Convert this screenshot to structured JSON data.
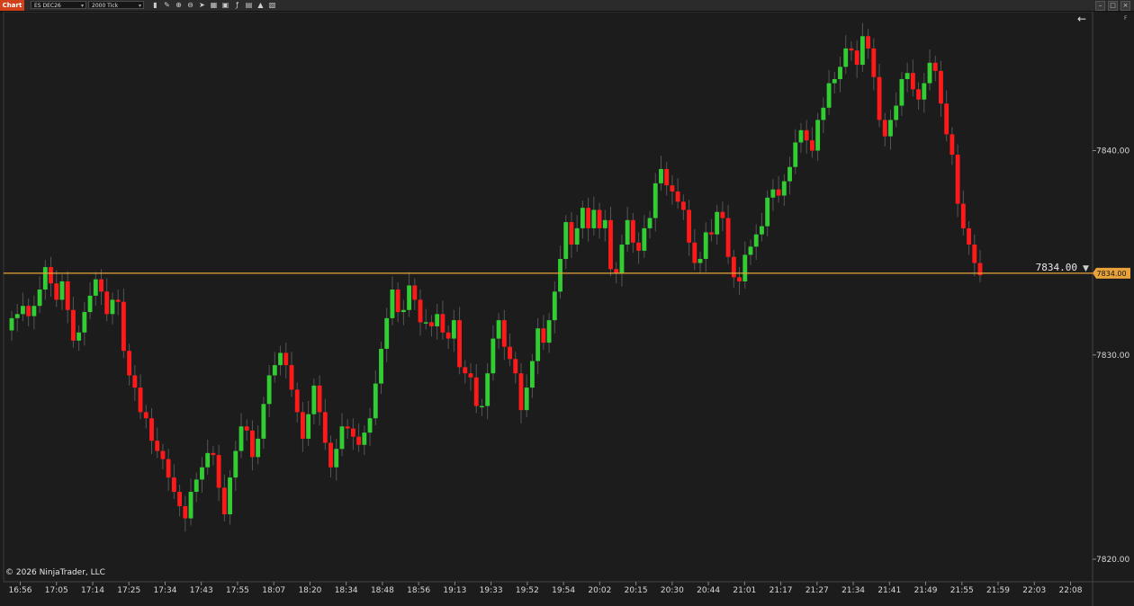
{
  "toolbar": {
    "tab_label": "Chart",
    "instrument": "ES DEC26",
    "interval": "2000 Tick",
    "icons": [
      "bar-type-icon",
      "draw-icon",
      "zoom-in-icon",
      "zoom-out-icon",
      "cursor-icon",
      "properties-icon",
      "strategy-icon",
      "indicator-icon",
      "template-icon",
      "share-icon",
      "copy-icon"
    ]
  },
  "copyright": "© 2026 NinjaTrader, LLC",
  "price_marker": {
    "value": 7834.0,
    "label": "7834.00",
    "badge": "7834.00",
    "color": "#e8a33a"
  },
  "colors": {
    "up": "#32cd32",
    "down": "#ff1a1a",
    "wick": "#555555",
    "grid": "#3a3a3a",
    "background": "#1c1c1c"
  },
  "chart_data": {
    "type": "candlestick",
    "instrument": "ES DEC26",
    "interval": "2000 Tick",
    "y_ticks": [
      "7820.00",
      "7830.00",
      "7840.00"
    ],
    "x_ticks": [
      "16:56",
      "17:05",
      "17:14",
      "17:25",
      "17:34",
      "17:43",
      "17:55",
      "18:07",
      "18:20",
      "18:34",
      "18:48",
      "18:56",
      "19:13",
      "19:33",
      "19:52",
      "19:54",
      "20:02",
      "20:15",
      "20:30",
      "20:44",
      "21:01",
      "21:17",
      "21:27",
      "21:34",
      "21:41",
      "21:49",
      "21:55",
      "21:59",
      "22:03",
      "22:08"
    ],
    "ylim": [
      7818.9,
      7846.8
    ],
    "last_price": 7834.0,
    "close": [
      7831.8,
      7832.0,
      7832.4,
      7831.9,
      7832.4,
      7833.2,
      7834.3,
      7833.5,
      7832.7,
      7833.6,
      7832.2,
      7830.7,
      7831.1,
      7832.1,
      7832.9,
      7833.7,
      7833.1,
      7832.0,
      7832.7,
      7832.6,
      7830.2,
      7829.0,
      7828.4,
      7827.2,
      7826.9,
      7825.8,
      7825.3,
      7824.9,
      7824.0,
      7823.3,
      7822.6,
      7822.0,
      7823.3,
      7823.9,
      7824.5,
      7825.2,
      7825.1,
      7823.5,
      7822.2,
      7824.0,
      7825.3,
      7826.5,
      7826.3,
      7825.0,
      7825.9,
      7827.6,
      7829.0,
      7829.5,
      7830.1,
      7829.5,
      7828.3,
      7827.2,
      7825.9,
      7827.1,
      7828.5,
      7827.2,
      7825.7,
      7824.5,
      7825.4,
      7826.5,
      7826.4,
      7826.0,
      7825.6,
      7826.2,
      7826.9,
      7828.6,
      7830.3,
      7831.8,
      7833.2,
      7832.1,
      7832.2,
      7833.4,
      7832.7,
      7831.6,
      7831.6,
      7831.4,
      7832.0,
      7831.1,
      7830.8,
      7831.7,
      7829.4,
      7829.1,
      7828.9,
      7827.5,
      7827.5,
      7829.1,
      7830.8,
      7831.7,
      7830.4,
      7829.8,
      7829.1,
      7827.3,
      7828.4,
      7829.7,
      7831.3,
      7830.6,
      7831.7,
      7833.1,
      7834.7,
      7836.5,
      7835.4,
      7836.2,
      7837.2,
      7836.2,
      7837.1,
      7836.2,
      7836.6,
      7834.2,
      7834.0,
      7835.4,
      7836.6,
      7835.5,
      7835.1,
      7836.2,
      7836.7,
      7838.4,
      7839.1,
      7838.3,
      7838.0,
      7837.5,
      7837.1,
      7835.5,
      7834.5,
      7834.7,
      7836.0,
      7835.9,
      7837.0,
      7836.7,
      7834.8,
      7833.8,
      7833.6,
      7834.9,
      7835.3,
      7835.9,
      7836.3,
      7837.7,
      7838.1,
      7837.8,
      7838.5,
      7839.2,
      7840.4,
      7841.0,
      7840.5,
      7840.0,
      7841.5,
      7842.1,
      7843.3,
      7843.5,
      7844.1,
      7845.0,
      7844.9,
      7844.2,
      7845.6,
      7845.0,
      7843.6,
      7841.5,
      7840.7,
      7841.5,
      7842.2,
      7843.5,
      7843.8,
      7843.0,
      7842.5,
      7843.3,
      7844.3,
      7843.9,
      7842.3,
      7840.8,
      7839.8,
      7837.4,
      7836.2,
      7835.4,
      7834.5,
      7833.9
    ]
  }
}
